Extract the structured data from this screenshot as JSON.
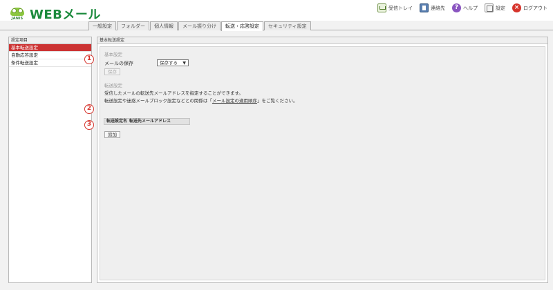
{
  "header": {
    "logo_sub": "JANIS",
    "app_title": "WEBメール",
    "links": [
      {
        "label": "受信トレイ",
        "icon": "inbox-icon"
      },
      {
        "label": "連絡先",
        "icon": "address-book-icon"
      },
      {
        "label": "ヘルプ",
        "icon": "help-icon"
      },
      {
        "label": "設定",
        "icon": "settings-icon"
      },
      {
        "label": "ログアウト",
        "icon": "logout-icon"
      }
    ]
  },
  "tabs": [
    {
      "label": "一般設定"
    },
    {
      "label": "フォルダー"
    },
    {
      "label": "個人情報"
    },
    {
      "label": "メール振り分け"
    },
    {
      "label": "転送・応答設定",
      "active": true
    },
    {
      "label": "セキュリティ設定"
    }
  ],
  "sidebar": {
    "heading": "設定項目",
    "items": [
      {
        "label": "基本転送設定",
        "active": true
      },
      {
        "label": "自動応答設定"
      },
      {
        "label": "条件転送設定"
      }
    ]
  },
  "main": {
    "heading": "基本転送設定",
    "basic": {
      "title": "基本設定",
      "save_mail_label": "メールの保存",
      "save_mail_value": "保存する",
      "save_button": "保存"
    },
    "forward": {
      "title": "転送設定",
      "desc1": "受信したメールの転送先メールアドレスを指定することができます。",
      "desc2_pre": "転送設定や迷惑メールブロック設定などとの関係は「",
      "desc2_link": "メール設定の適用順序",
      "desc2_post": "」をご覧ください。",
      "columns": [
        "転送設定名",
        "転送先メールアドレス"
      ],
      "add_button": "追加"
    }
  },
  "callouts": [
    "1",
    "2",
    "3"
  ],
  "colors": {
    "accent_red": "#cc3333",
    "logo_green": "#1b8a3c",
    "callout_red": "#d6342c"
  }
}
